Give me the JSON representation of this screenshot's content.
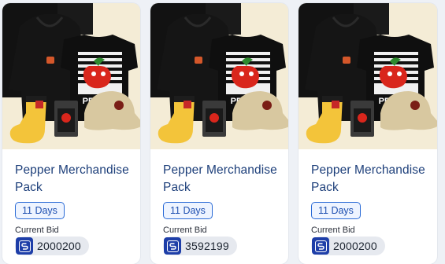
{
  "cards": [
    {
      "image_alt": "Pepper merchandise: black hoodie, black t-shirt with PEPPER print, yellow socks, trading card, beige cap",
      "title": "Pepper Merchandise Pack",
      "title_overflow": "C",
      "days": "11 Days",
      "bid_label": "Current Bid",
      "currency_icon": "token-icon",
      "bid": "2000200"
    },
    {
      "image_alt": "Pepper merchandise: black hoodie, black t-shirt with PEPPER print, yellow socks, trading card, beige cap",
      "title": "Pepper Merchandise Pack",
      "title_overflow": "C",
      "days": "11 Days",
      "bid_label": "Current Bid",
      "currency_icon": "token-icon",
      "bid": "3592199"
    },
    {
      "image_alt": "Pepper merchandise: black hoodie, black t-shirt with PEPPER print, yellow socks, trading card, beige cap",
      "title": "Pepper Merchandise Pack",
      "title_overflow": "C",
      "days": "11 Days",
      "bid_label": "Current Bid",
      "currency_icon": "token-icon",
      "bid": "2000200"
    }
  ],
  "product_print_text": "PEPPER",
  "colors": {
    "title": "#1d3f7a",
    "badge_border": "#2b6bd6",
    "coin": "#1e3ea8",
    "bid_pill": "#e6e9ef"
  }
}
